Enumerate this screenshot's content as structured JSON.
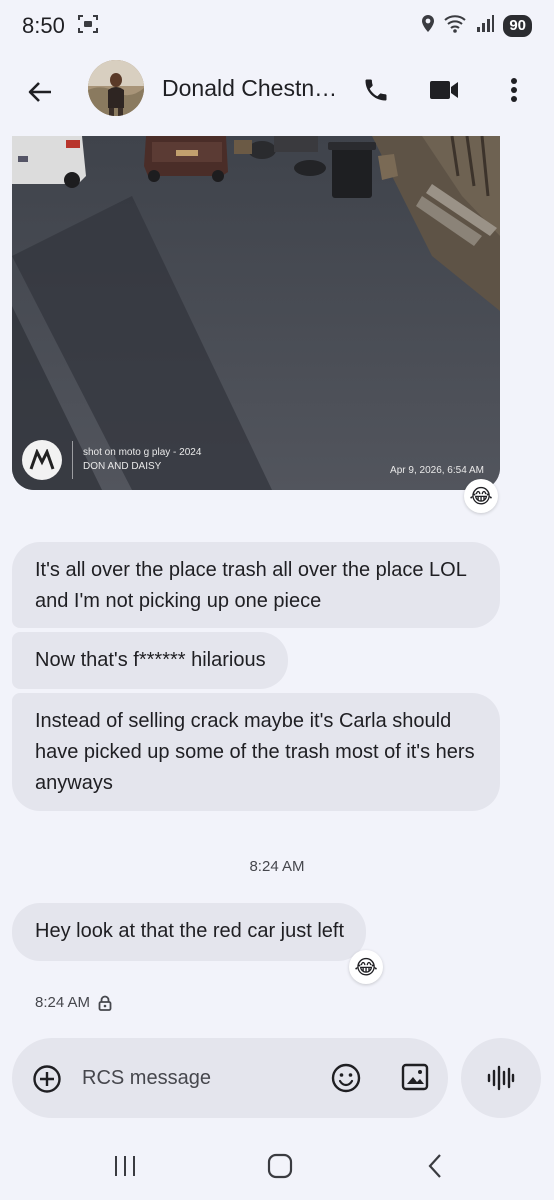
{
  "status_bar": {
    "time": "8:50",
    "battery": "90"
  },
  "header": {
    "contact_name": "Donald Chestn…",
    "icons": [
      "back-arrow-icon",
      "phone-icon",
      "video-icon",
      "more-vert-icon"
    ]
  },
  "photo": {
    "watermark_line1": "shot on moto g play - 2024",
    "watermark_line2": "DON AND DAISY",
    "watermark_date": "Apr 9, 2026, 6:54 AM",
    "reaction": "😂"
  },
  "messages": [
    {
      "text": "It's all over the place trash all over the place LOL and I'm not picking up one piece"
    },
    {
      "text": "Now that's f****** hilarious"
    },
    {
      "text": "Instead of selling crack maybe it's Carla should have picked up some of the trash most of it's hers anyways"
    }
  ],
  "time_divider": "8:24 AM",
  "last_message": {
    "text": "Hey look at that the red car just left",
    "reaction": "😂"
  },
  "message_status": {
    "time": "8:24 AM",
    "icon": "lock-icon"
  },
  "compose": {
    "placeholder": "RCS message",
    "icons": [
      "add-icon",
      "emoji-icon",
      "gallery-icon",
      "voice-icon"
    ]
  },
  "colors": {
    "background": "#f2f3fa",
    "bubble": "#e4e5ed",
    "text": "#1f1f23"
  }
}
